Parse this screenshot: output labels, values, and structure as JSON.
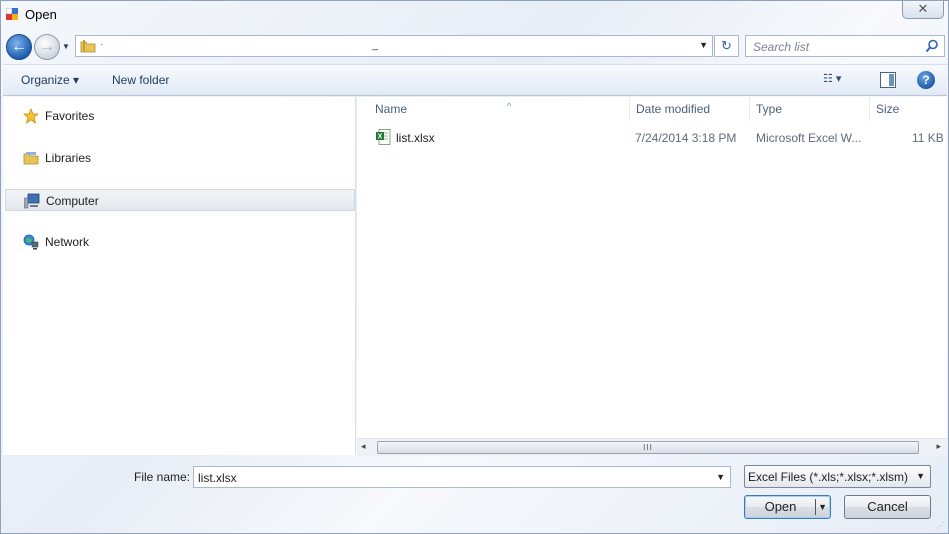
{
  "window": {
    "title": "Open",
    "close_glyph": "✕"
  },
  "address_bar": {
    "path_text": "·",
    "cursor_text": "_",
    "refresh_glyph": "↻"
  },
  "search": {
    "placeholder": "Search list"
  },
  "toolbar": {
    "organize_label": "Organize ▾",
    "new_folder_label": "New folder",
    "views_glyph": "☷ ▾",
    "help_glyph": "?"
  },
  "nav_pane": {
    "items": [
      {
        "label": "Favorites",
        "icon": "star-icon"
      },
      {
        "label": "Libraries",
        "icon": "libraries-icon"
      },
      {
        "label": "Computer",
        "icon": "computer-icon",
        "selected": true
      },
      {
        "label": "Network",
        "icon": "network-icon"
      }
    ]
  },
  "file_list": {
    "columns": [
      "Name",
      "Date modified",
      "Type",
      "Size"
    ],
    "rows": [
      {
        "name": "list.xlsx",
        "date_modified": "7/24/2014 3:18 PM",
        "type": "Microsoft Excel W...",
        "size": "11 KB",
        "icon": "excel-file-icon"
      }
    ]
  },
  "scrollbar": {
    "thumb_glyph": "III",
    "left_arrow": "◂",
    "right_arrow": "▸"
  },
  "footer": {
    "file_name_label": "File name:",
    "file_name_value": "list.xlsx",
    "file_type_value": "Excel Files (*.xls;*.xlsx;*.xlsm)",
    "open_label": "Open",
    "cancel_label": "Cancel"
  },
  "colors": {
    "accent": "#1f5fb2",
    "toolbar_text": "#1e395b",
    "header_text": "#4c607a"
  }
}
